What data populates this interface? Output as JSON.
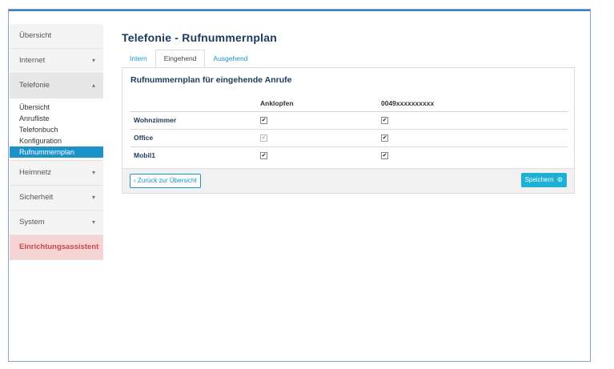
{
  "sidebar": {
    "items_top": [
      {
        "label": "Übersicht",
        "chevron": ""
      },
      {
        "label": "Internet",
        "chevron": "▾"
      },
      {
        "label": "Telefonie",
        "chevron": "▴"
      }
    ],
    "submenu": [
      {
        "label": "Übersicht"
      },
      {
        "label": "Anrufliste"
      },
      {
        "label": "Telefonbuch"
      },
      {
        "label": "Konfiguration"
      },
      {
        "label": "Rufnummernplan"
      }
    ],
    "items_bottom": [
      {
        "label": "Heimnetz",
        "chevron": "▾"
      },
      {
        "label": "Sicherheit",
        "chevron": "▾"
      },
      {
        "label": "System",
        "chevron": "▾"
      }
    ],
    "assistant_label": "Einrichtungsassistent"
  },
  "main": {
    "title": "Telefonie - Rufnummernplan",
    "tabs": [
      {
        "label": "Intern"
      },
      {
        "label": "Eingehend"
      },
      {
        "label": "Ausgehend"
      }
    ],
    "panel_title": "Rufnummernplan für eingehende Anrufe",
    "columns": [
      "",
      "Anklopfen",
      "0049xxxxxxxxxx"
    ],
    "rows": [
      {
        "name": "Wohnzimmer",
        "anklopfen": "✔",
        "number": "✔"
      },
      {
        "name": "Office",
        "anklopfen": "✔",
        "number": "✔"
      },
      {
        "name": "Mobil1",
        "anklopfen": "✔",
        "number": "✔"
      }
    ],
    "back_label": "‹ Zurück zur Übersicht",
    "save_label": "Speichern"
  },
  "colors": {
    "accent": "#1b92c8",
    "assistant_bg": "#f6d4d4",
    "assistant_text": "#c94848",
    "title": "#1b3a5c"
  }
}
